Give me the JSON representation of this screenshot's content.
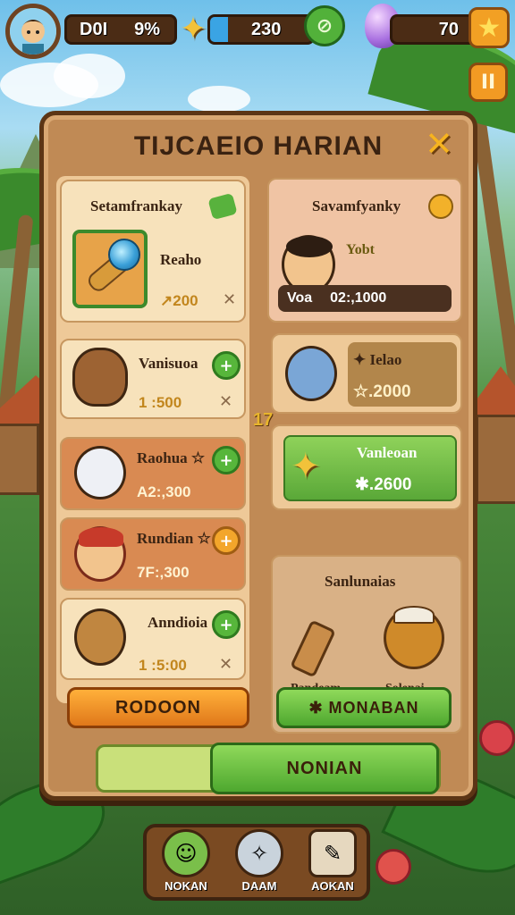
{
  "hud": {
    "stat_left": "D0I",
    "stat_percent": "9%",
    "stat_middle": "230",
    "stat_right": "70",
    "pause_label": "II"
  },
  "panel": {
    "title": "TIJCAEIO HARIAN",
    "close_symbol": "✕"
  },
  "left_feature": {
    "title": "Setamfrankay",
    "name": "Reaho",
    "value": "↗200",
    "remove": "✕"
  },
  "right_feature": {
    "title": "Savamfyanky",
    "label": "Yobt",
    "caption": "Voa",
    "value": "02:,1000"
  },
  "left_items": [
    {
      "name": "Vanisuoa",
      "value": "1 :500",
      "remove": "✕",
      "action": "+"
    },
    {
      "name": "Raohua ☆",
      "value": "A2:,300",
      "action": "+"
    },
    {
      "name": "Rundian ☆",
      "value": "7F:,300",
      "action": "+"
    },
    {
      "name": "Anndioia",
      "value": "1 :5:00",
      "remove": "✕",
      "action": "+"
    }
  ],
  "right_items": [
    {
      "name": "✦ Ielao",
      "value": "☆.2000"
    },
    {
      "name": "Vanleoan",
      "value": "✱.2600"
    }
  ],
  "connector": "17",
  "shop": {
    "title": "Sanlunaias",
    "items": [
      "Pandeam",
      "Solenai"
    ]
  },
  "buttons": {
    "left": "RODOON",
    "right": "✱ MONABAN",
    "progress": "NONIAN"
  },
  "tabs": [
    {
      "label": "NOKAN"
    },
    {
      "label": "DAAM"
    },
    {
      "label": "AOKAN"
    }
  ]
}
